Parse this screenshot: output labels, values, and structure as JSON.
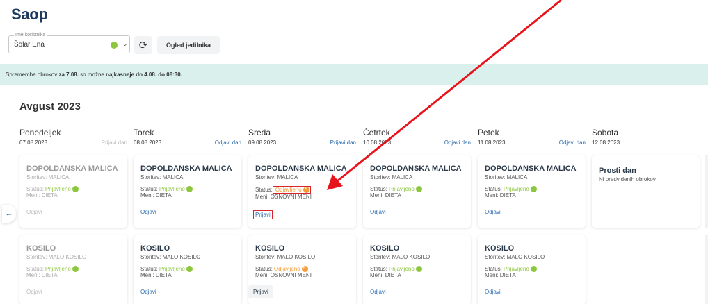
{
  "app": {
    "logo": "Saop"
  },
  "toolbar": {
    "user_label": "Ime koristnika",
    "user_value": "Šolar Ena",
    "refresh_glyph": "⟳",
    "menu_button": "Ogled jedilnika"
  },
  "banner": {
    "prefix": "Spremembe obrokov ",
    "date": "za 7.08.",
    "middle": " so možne ",
    "deadline": "najkasneje do 4.08. do 08:30."
  },
  "month": "Avgust 2023",
  "days": [
    {
      "name": "Ponedeljek",
      "date": "07.08.2023",
      "action": "Prijavi dan"
    },
    {
      "name": "Torek",
      "date": "08.08.2023",
      "action": "Odjavi dan"
    },
    {
      "name": "Sreda",
      "date": "09.08.2023",
      "action": "Prijavi dan"
    },
    {
      "name": "Četrtek",
      "date": "10.08.2023",
      "action": "Odjavi dan"
    },
    {
      "name": "Petek",
      "date": "11.08.2023",
      "action": "Odjavi dan"
    },
    {
      "name": "Sobota",
      "date": "12.08.2023",
      "action": ""
    }
  ],
  "labels": {
    "status": "Status:",
    "meni_prefix": "Meni: "
  },
  "snack": {
    "title": "DOPOLDANSKA MALICA",
    "service": "Storitev: MALICA",
    "cards": [
      {
        "status": "Prijavljeno",
        "menu": "DIETA",
        "action": "Odjavi"
      },
      {
        "status": "Prijavljeno",
        "menu": "DIETA",
        "action": "Odjavi"
      },
      {
        "status": "Odjavljeno",
        "menu": "OSNOVNI MENI",
        "action": "Prijavi"
      },
      {
        "status": "Prijavljeno",
        "menu": "DIETA",
        "action": "Odjavi"
      },
      {
        "status": "Prijavljeno",
        "menu": "DIETA",
        "action": "Odjavi"
      }
    ]
  },
  "lunch": {
    "title": "KOSILO",
    "service": "Storitev: MALO KOSILO",
    "cards": [
      {
        "status": "Prijavljeno",
        "menu": "DIETA",
        "action": "Odjavi"
      },
      {
        "status": "Prijavljeno",
        "menu": "DIETA",
        "action": "Odjavi"
      },
      {
        "status": "Odjavljeno",
        "menu": "OSNOVNI MENI",
        "action": "Prijavi"
      },
      {
        "status": "Prijavljeno",
        "menu": "DIETA",
        "action": "Odjavi"
      },
      {
        "status": "Prijavljeno",
        "menu": "DIETA",
        "action": "Odjavi"
      }
    ]
  },
  "free_day": {
    "title": "Prosti dan",
    "subtitle": "Ni predvidenih obrokov"
  },
  "nav": {
    "prev_glyph": "←"
  },
  "colors": {
    "ok": "#8dc63f",
    "cancelled": "#f29b38",
    "link": "#2b6cb0",
    "highlight": "#d9232e",
    "banner": "#daf0ec"
  }
}
